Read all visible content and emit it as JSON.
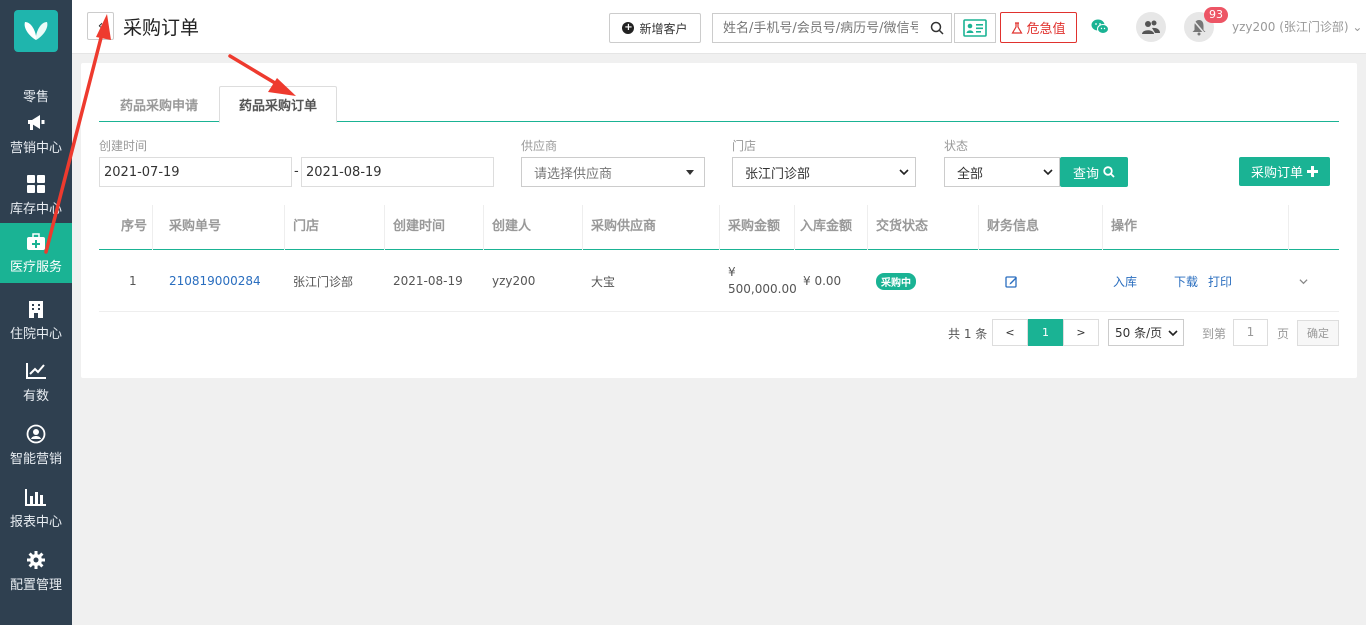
{
  "sidebar": {
    "items": [
      {
        "label": "零售",
        "icon": "retail-icon"
      },
      {
        "label": "营销中心",
        "icon": "megaphone-icon"
      },
      {
        "label": "库存中心",
        "icon": "grid-icon"
      },
      {
        "label": "医疗服务",
        "icon": "medical-kit-icon",
        "active": true
      },
      {
        "label": "住院中心",
        "icon": "hospital-icon"
      },
      {
        "label": "有数",
        "icon": "line-chart-icon"
      },
      {
        "label": "智能营销",
        "icon": "smart-marketing-icon"
      },
      {
        "label": "报表中心",
        "icon": "bar-chart-icon"
      },
      {
        "label": "配置管理",
        "icon": "gear-icon"
      }
    ]
  },
  "header": {
    "back_label": "‹",
    "title": "采购订单",
    "add_customer_label": "新增客户",
    "search_placeholder": "姓名/手机号/会员号/病历号/微信号",
    "danger_label": "危急值",
    "notification_count": "93",
    "user_label": "yzy200 (张江门诊部)"
  },
  "tabs": [
    {
      "label": "药品采购申请",
      "active": false
    },
    {
      "label": "药品采购订单",
      "active": true
    }
  ],
  "filters": {
    "created_label": "创建时间",
    "date_from": "2021-07-19",
    "date_sep": "-",
    "date_to": "2021-08-19",
    "supplier_label": "供应商",
    "supplier_placeholder": "请选择供应商",
    "store_label": "门店",
    "store_value": "张江门诊部",
    "status_label": "状态",
    "status_value": "全部",
    "query_label": "查询",
    "purchase_order_label": "采购订单"
  },
  "table": {
    "columns": [
      "序号",
      "采购单号",
      "门店",
      "创建时间",
      "创建人",
      "采购供应商",
      "采购金额",
      "入库金额",
      "交货状态",
      "财务信息",
      "操作",
      ""
    ],
    "rows": [
      {
        "index": "1",
        "order_no": "210819000284",
        "store": "张江门诊部",
        "created": "2021-08-19",
        "creator": "yzy200",
        "supplier": "大宝",
        "amount_symbol": "¥",
        "amount": "500,000.00",
        "inbound_amount": "¥ 0.00",
        "status": "采购中",
        "actions": [
          "入库",
          "下载",
          "打印"
        ]
      }
    ]
  },
  "pagination": {
    "total": "共 1 条",
    "prev": "<",
    "current": "1",
    "next": ">",
    "page_size": "50 条/页",
    "goto_label": "到第",
    "goto_value": "1",
    "page_unit": "页",
    "confirm_label": "确定"
  },
  "colors": {
    "sidebar_bg": "#2f4050",
    "accent": "#1ab394",
    "danger": "#e0322e",
    "link": "#2a6ebf",
    "badge": "#ed5565",
    "annotation_arrow": "#ee3a2e"
  }
}
